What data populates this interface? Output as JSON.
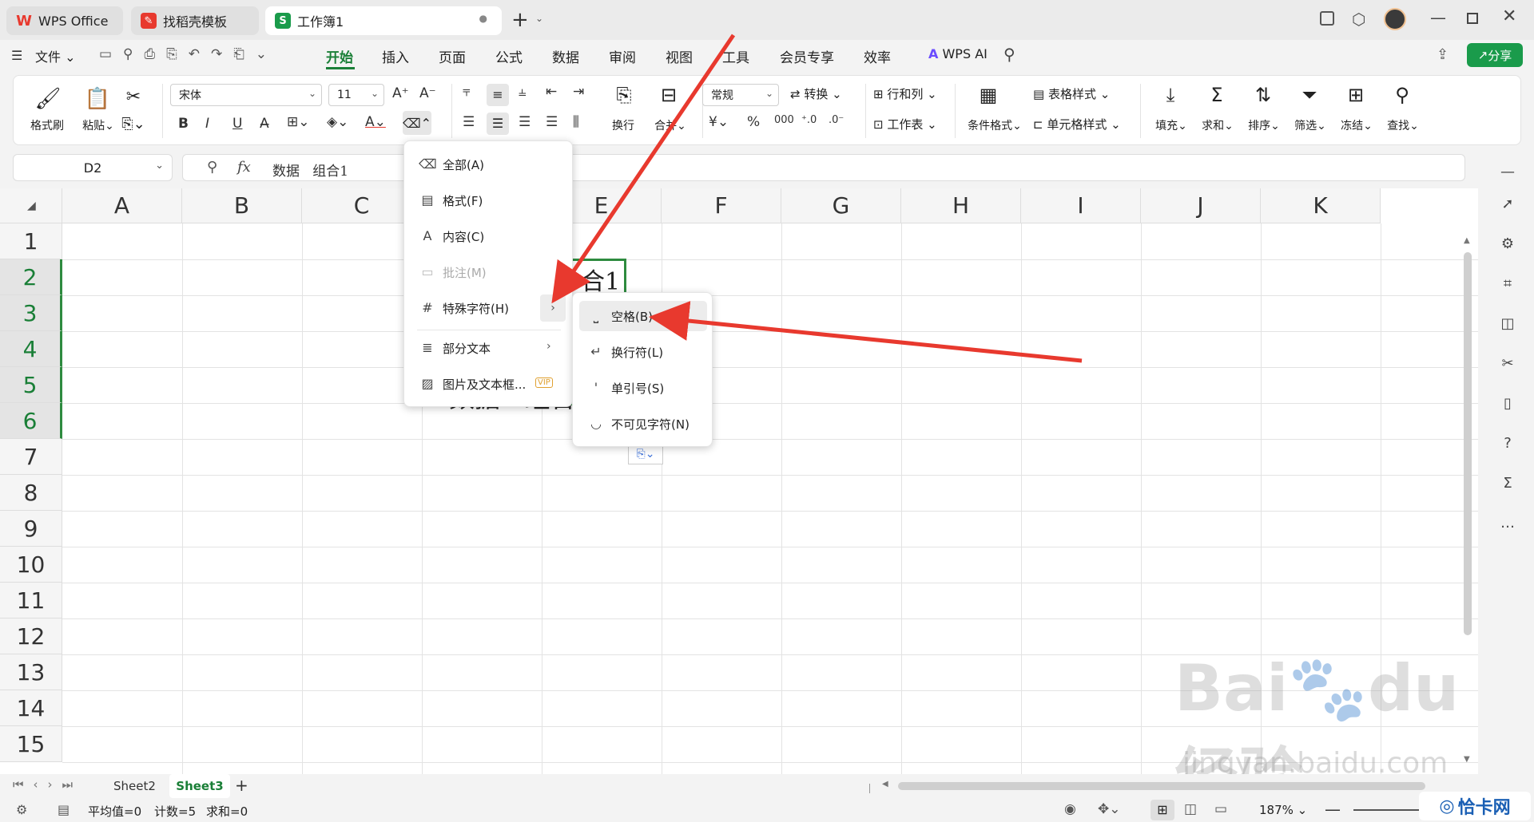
{
  "titlebar": {
    "tabs": [
      {
        "label": "WPS Office"
      },
      {
        "label": "找稻壳模板"
      },
      {
        "label": "工作簿1"
      }
    ],
    "new_tab": "+"
  },
  "menu": {
    "file": "文件",
    "tabs": [
      "开始",
      "插入",
      "页面",
      "公式",
      "数据",
      "审阅",
      "视图",
      "工具",
      "会员专享",
      "效率"
    ],
    "active_tab": "开始",
    "wps_ai": "WPS AI",
    "share": "分享"
  },
  "ribbon": {
    "format_painter": "格式刷",
    "paste": "粘贴",
    "font_name": "宋体",
    "font_size": "11",
    "wrap": "换行",
    "merge": "合并",
    "number_format": "常规",
    "convert": "转换",
    "row_col": "行和列",
    "worksheet": "工作表",
    "cond_format": "条件格式",
    "table_style": "表格样式",
    "cell_style": "单元格样式",
    "fill": "填充",
    "sum": "求和",
    "sort": "排序",
    "filter": "筛选",
    "freeze": "冻结",
    "find": "查找",
    "bold": "B",
    "italic": "I",
    "underline": "U",
    "currency": "¥",
    "percent": "%"
  },
  "formula_bar": {
    "cell_ref": "D2",
    "fx": "fx",
    "content": "数据   组合1"
  },
  "grid": {
    "columns": [
      "A",
      "B",
      "C",
      "D",
      "E",
      "F",
      "G",
      "H",
      "I",
      "J",
      "K"
    ],
    "rows": [
      "1",
      "2",
      "3",
      "4",
      "5",
      "6",
      "7",
      "8",
      "9",
      "10",
      "11",
      "12",
      "13",
      "14",
      "15"
    ],
    "cell_d2_visible": "合1",
    "cell_d6_visible": "数据   组合"
  },
  "clear_menu": {
    "items": [
      {
        "label": "全部(A)"
      },
      {
        "label": "格式(F)"
      },
      {
        "label": "内容(C)"
      },
      {
        "label": "批注(M)"
      },
      {
        "label": "特殊字符(H)"
      },
      {
        "label": "部分文本"
      },
      {
        "label": "图片及文本框..."
      }
    ],
    "vip": "VIP"
  },
  "special_menu": {
    "items": [
      {
        "label": "空格(B)"
      },
      {
        "label": "换行符(L)"
      },
      {
        "label": "单引号(S)"
      },
      {
        "label": "不可见字符(N)"
      }
    ]
  },
  "sheets": {
    "tabs": [
      "Sheet2",
      "Sheet3"
    ],
    "active": "Sheet3",
    "add": "+"
  },
  "status": {
    "average": "平均值=0",
    "count": "计数=5",
    "sum": "求和=0",
    "zoom": "187%"
  },
  "watermark": {
    "baidu": "Bai",
    "du": "du",
    "jingyan": "经验",
    "url": "jingyan.baidu.com",
    "corner": "恰卡网"
  },
  "colors": {
    "accent_green": "#1a7f37",
    "annotation_red": "#e8392e"
  }
}
